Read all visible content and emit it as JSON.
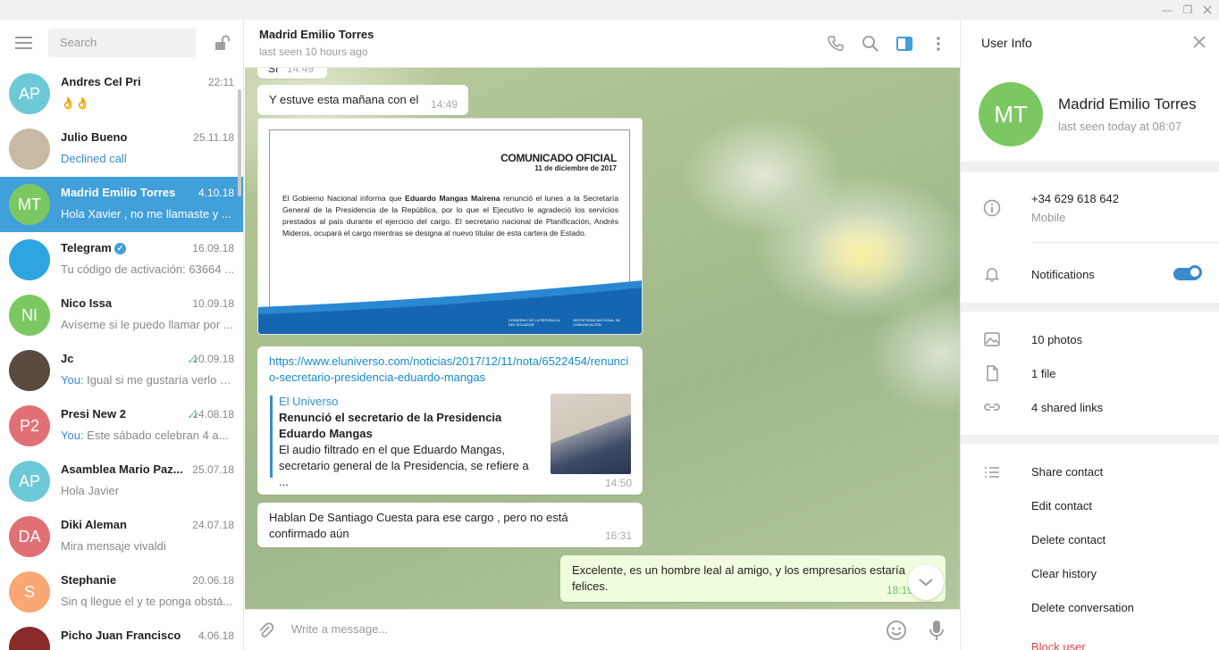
{
  "window": {
    "minimize": "—",
    "restore": "❐"
  },
  "sidebar": {
    "search_placeholder": "Search",
    "chats": [
      {
        "initials": "AP",
        "avatar_color": "#6dc9d7",
        "name": "Andres Cel Pri",
        "date": "22:11",
        "preview": "👌👌",
        "you": "",
        "checks": false
      },
      {
        "initials": "",
        "avatar_color": "#c9b9a3",
        "name": "Julio Bueno",
        "date": "25.11.18",
        "preview": "Declined call",
        "you": "",
        "checks": false
      },
      {
        "initials": "MT",
        "avatar_color": "#7bc862",
        "name": "Madrid Emilio Torres",
        "date": "4.10.18",
        "preview": "Hola Xavier , no me llamaste y ...",
        "you": "",
        "checks": false
      },
      {
        "initials": "",
        "avatar_color": "#2ca5e0",
        "name": "Telegram",
        "date": "16.09.18",
        "preview": "Tu código de activación: 63664 ...",
        "you": "",
        "checks": false
      },
      {
        "initials": "NI",
        "avatar_color": "#7bc862",
        "name": "Nico Issa",
        "date": "10.09.18",
        "preview": "Avíseme si le puedo llamar por ...",
        "you": "",
        "checks": false
      },
      {
        "initials": "",
        "avatar_color": "#5a4a3f",
        "name": "Jc",
        "date": "10.09.18",
        "preview": " Igual si me gustaría verlo s...",
        "you": "You:",
        "checks": true
      },
      {
        "initials": "P2",
        "avatar_color": "#e17076",
        "name": "Presi New 2",
        "date": "14.08.18",
        "preview": " Este sábado celebran 4 a...",
        "you": "You:",
        "checks": true
      },
      {
        "initials": "AP",
        "avatar_color": "#6dc9d7",
        "name": "Asamblea Mario Paz...",
        "date": "25.07.18",
        "preview": "Hola Javier",
        "you": "",
        "checks": false
      },
      {
        "initials": "DA",
        "avatar_color": "#e17076",
        "name": "Diki Aleman",
        "date": "24.07.18",
        "preview": "Mira mensaje vivaldi",
        "you": "",
        "checks": false
      },
      {
        "initials": "S",
        "avatar_color": "#faa774",
        "name": "Stephanie",
        "date": "20.06.18",
        "preview": "Sin q llegue el y te ponga obstá...",
        "you": "",
        "checks": false
      },
      {
        "initials": "",
        "avatar_color": "#8a2a2a",
        "name": "Picho Juan Francisco",
        "date": "4.06.18",
        "preview": "",
        "you": "",
        "checks": false
      }
    ]
  },
  "chat": {
    "peer_name": "Madrid Emilio Torres",
    "peer_status": "last seen 10 hours ago",
    "composer_placeholder": "Write a message...",
    "messages": {
      "top_partial_text": "Sí",
      "top_partial_time": "14:49",
      "m1_text": "Y estuve esta mañana con el",
      "m1_time": "14:49",
      "doc_title": "COMUNICADO OFICIAL",
      "doc_date": "11 de diciembre de 2017",
      "doc_body_1": "El Gobierno Nacional informa que ",
      "doc_body_bold": "Eduardo Mangas Mairena",
      "doc_body_2": " renunció el lunes a la Secretaría General de la Presidencia de la República, por lo que el Ejecutivo le agradeció los servicios prestados al país durante el ejercicio del cargo. El secretario nacional de Planificación, Andrés Mideros, ocupará el cargo mientras se designa al nuevo titular de esta cartera de Estado.",
      "doc_logo_1": "GOBIERNO DE LA REPÚBLICA DEL ECUADOR",
      "doc_logo_2": "SECRETARÍA NACIONAL DE COMUNICACIÓN",
      "link_url": "https://www.eluniverso.com/noticias/2017/12/11/nota/6522454/renuncio-secretario-presidencia-eduardo-mangas",
      "wp_site": "El Universo",
      "wp_title": "Renunció el secretario de la Presidencia Eduardo Mangas",
      "wp_desc": "El audio filtrado en el que Eduardo Mangas, secretario general de la Presidencia, se refiere a ...",
      "link_time": "14:50",
      "m3_text": "Hablan De Santiago Cuesta para ese cargo , pero no está confirmado aún",
      "m3_time": "16:31",
      "m4_text": "Excelente, es un hombre leal al amigo, y los empresarios estaría felices.",
      "m4_time": "18:19"
    }
  },
  "user_info": {
    "title": "User Info",
    "initials": "MT",
    "avatar_color": "#7bc862",
    "name": "Madrid Emilio Torres",
    "status": "last seen today at 08:07",
    "phone": "+34 629 618 642",
    "phone_label": "Mobile",
    "notifications_label": "Notifications",
    "notifications_on": true,
    "photos": "10 photos",
    "files": "1 file",
    "links": "4 shared links",
    "actions": {
      "share": "Share contact",
      "edit": "Edit contact",
      "delete": "Delete contact",
      "clear": "Clear history",
      "delete_conv": "Delete conversation",
      "block": "Block user"
    }
  },
  "colors": {
    "accent": "#419fd9",
    "out_bubble": "#effdde",
    "danger": "#d24949"
  }
}
